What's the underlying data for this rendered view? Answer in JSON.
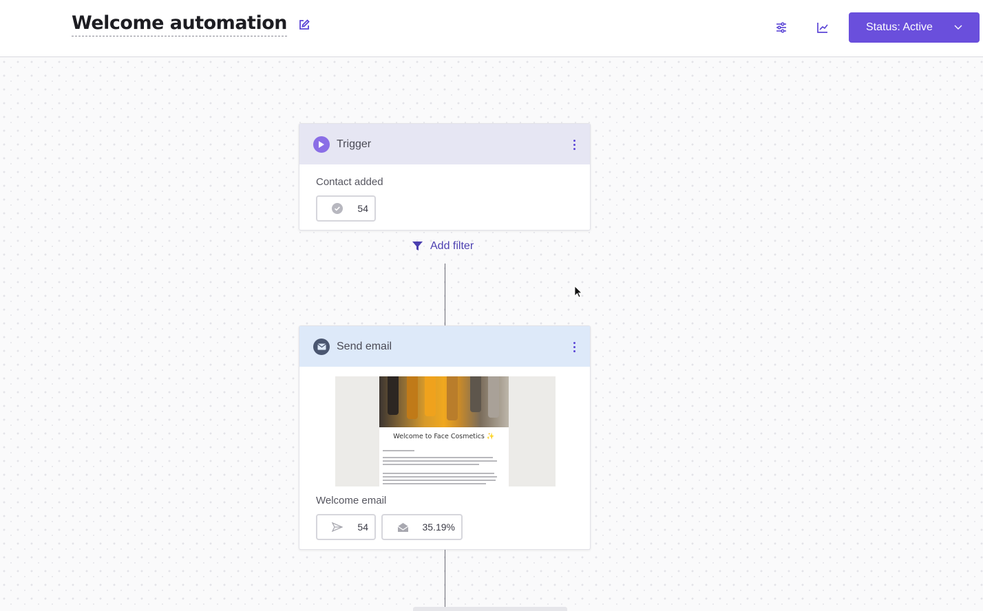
{
  "header": {
    "title": "Welcome automation",
    "status_label": "Status: Active",
    "edit_icon": "edit-icon",
    "settings_icon": "sliders-icon",
    "analytics_icon": "chart-line-icon",
    "accent_color": "#6a4fdc"
  },
  "trigger_card": {
    "label": "Trigger",
    "event": "Contact added",
    "count": "54",
    "head_color": "#e6e6f3",
    "icon": "play-icon"
  },
  "filter": {
    "label": "Add filter",
    "icon": "funnel-icon"
  },
  "email_card": {
    "label": "Send email",
    "email_name": "Welcome email",
    "sent_count": "54",
    "open_rate": "35.19%",
    "head_color": "#dde9f9",
    "icon": "envelope-icon",
    "preview": {
      "heading": "Welcome to Face Cosmetics ✨"
    }
  }
}
